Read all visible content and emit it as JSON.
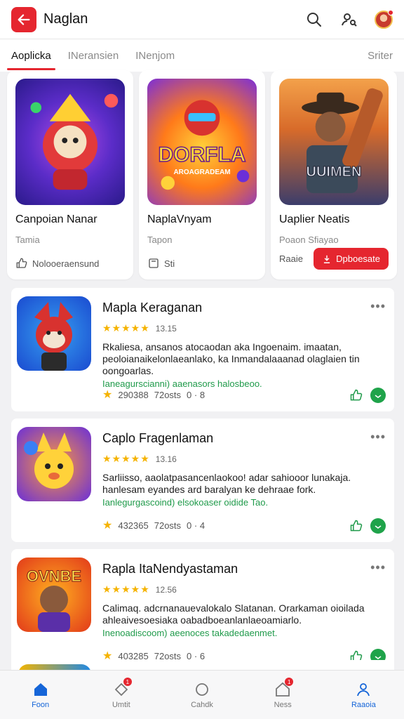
{
  "header": {
    "title": "Naglan",
    "back_icon": "back-arrow-icon",
    "search_icon": "search-icon",
    "profile_icon": "user-search-icon",
    "avatar_icon": "avatar",
    "accent": "#e5262f"
  },
  "tabs": [
    {
      "label": "Aoplicka",
      "active": true
    },
    {
      "label": "INeransien",
      "active": false
    },
    {
      "label": "INenjom",
      "active": false
    },
    {
      "label": "Sriter",
      "active": false
    }
  ],
  "featured": [
    {
      "title": "Canpoian Nanar",
      "subtitle": "Tamia",
      "action_icon": "thumbs-up-icon",
      "action_label": "Nolooeraensund"
    },
    {
      "title": "NaplaVnyam",
      "subtitle": "Tapon",
      "action_icon": "box-icon",
      "action_label": "Sti",
      "art_text": "DORFLA",
      "art_subtext": "AROAGRADEAM"
    },
    {
      "title": "Uaplier Neatis",
      "subtitle": "Poaon Sfiayao",
      "action_label": "Raaie",
      "button_label": "Dpboesate",
      "art_text": "UUIMEN"
    }
  ],
  "list": [
    {
      "name": "Mapla Keraganan",
      "rating_value": "13.15",
      "description": "Rkaliesa, ansanos atocaodan aka Ingoenaim. imaatan, peoloianaikelonlaeanlako, ka Inmandalaaanad olaglaien tin oongoarlas.",
      "highlight": "Ianeagurscianni) aaenasors halosbeoo.",
      "meta_count": "290388",
      "meta_time": "72osts",
      "meta_extra": "0 · 8"
    },
    {
      "name": "Caplo Fragenlaman",
      "rating_value": "13.16",
      "description": "Sarliisso, aaolatpasancenlaokoo! adar sahiooor lunakaja. hanlesam eyandes ard baralyan ke dehraae fork.",
      "highlight": "Ianlegurgascoind) elsokoaser oidide Tao.",
      "meta_count": "432365",
      "meta_time": "72osts",
      "meta_extra": "0 · 4"
    },
    {
      "name": "Rapla ItaNendyastaman",
      "rating_value": "12.56",
      "description": "Calimaq. adcrnanauevalokalo Slatanan. Orarkaman oioilada ahleaivesoesiaka oabadboeanlanlaeoamiarlo.",
      "highlight": "Inenoadiscoom) aeenoces takadedaenmet.",
      "meta_count": "403285",
      "meta_time": "72osts",
      "meta_extra": "0 · 6",
      "art_text": "OVNBE"
    }
  ],
  "bottom_nav": [
    {
      "label": "Foon",
      "icon": "home-icon",
      "active": true
    },
    {
      "label": "Umtit",
      "icon": "tag-icon",
      "badge": "1"
    },
    {
      "label": "Cahdk",
      "icon": "circle-icon"
    },
    {
      "label": "Ness",
      "icon": "house-icon",
      "badge": "1"
    },
    {
      "label": "Raaoia",
      "icon": "person-icon"
    }
  ]
}
